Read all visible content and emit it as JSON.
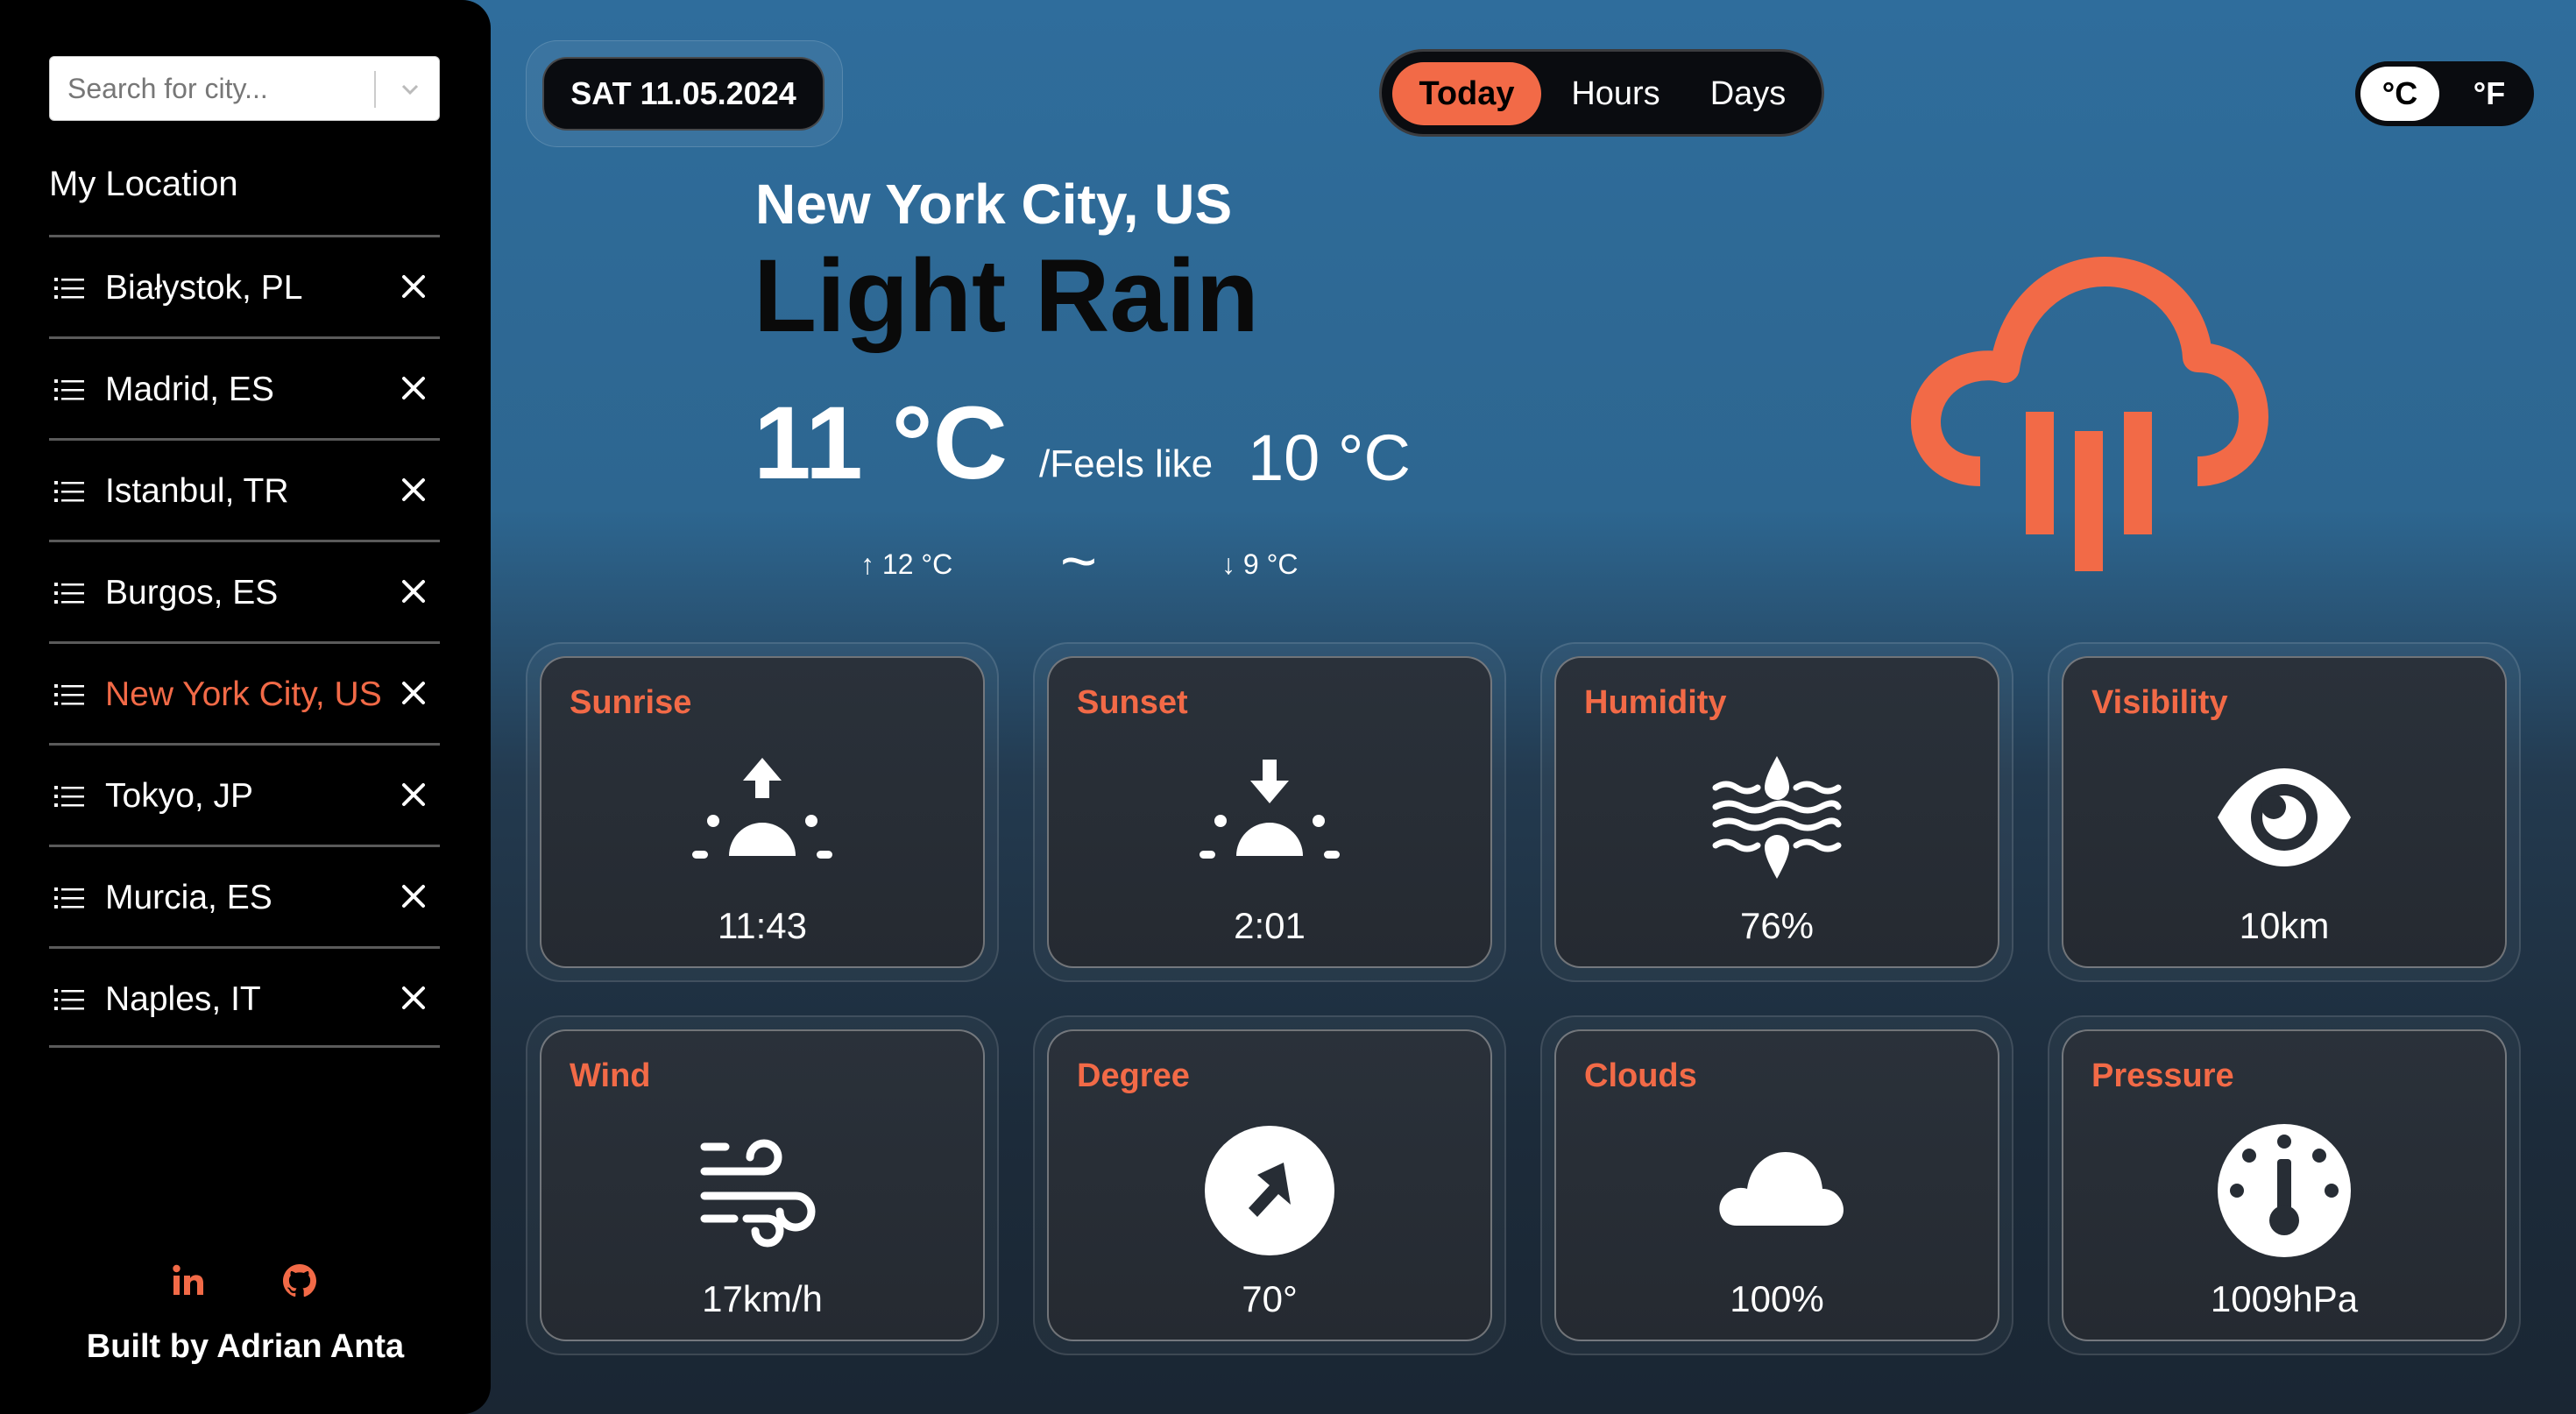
{
  "search": {
    "placeholder": "Search for city..."
  },
  "sidebar": {
    "my_location": "My Location",
    "locations": [
      {
        "name": "Białystok, PL",
        "active": false
      },
      {
        "name": "Madrid, ES",
        "active": false
      },
      {
        "name": "Istanbul, TR",
        "active": false
      },
      {
        "name": "Burgos, ES",
        "active": false
      },
      {
        "name": "New York City, US",
        "active": true
      },
      {
        "name": "Tokyo, JP",
        "active": false
      },
      {
        "name": "Murcia, ES",
        "active": false
      },
      {
        "name": "Naples, IT",
        "active": false
      }
    ],
    "social": [
      "linkedin-icon",
      "github-icon"
    ],
    "built_by": "Built by Adrian Anta"
  },
  "header": {
    "date": "SAT 11.05.2024",
    "tabs": [
      "Today",
      "Hours",
      "Days"
    ],
    "active_tab": "Today",
    "units": [
      "°C",
      "°F"
    ],
    "active_unit": "°C"
  },
  "current": {
    "city": "New York City, US",
    "condition": "Light Rain",
    "temp": "11 °C",
    "feels_label": "/Feels like",
    "feels_value": "10 °C",
    "high": "↑ 12 °C",
    "separator": "~",
    "low": "↓ 9 °C",
    "icon": "rain-cloud-icon"
  },
  "cards": [
    {
      "label": "Sunrise",
      "value": "11:43",
      "icon": "sunrise-icon"
    },
    {
      "label": "Sunset",
      "value": "2:01",
      "icon": "sunset-icon"
    },
    {
      "label": "Humidity",
      "value": "76%",
      "icon": "humidity-icon"
    },
    {
      "label": "Visibility",
      "value": "10km",
      "icon": "eye-icon"
    },
    {
      "label": "Wind",
      "value": "17km/h",
      "icon": "wind-icon"
    },
    {
      "label": "Degree",
      "value": "70°",
      "icon": "compass-icon"
    },
    {
      "label": "Clouds",
      "value": "100%",
      "icon": "cloud-icon"
    },
    {
      "label": "Pressure",
      "value": "1009hPa",
      "icon": "gauge-icon"
    }
  ],
  "colors": {
    "accent": "#f26a47",
    "sidebar": "#000000",
    "card": "#272d35"
  }
}
